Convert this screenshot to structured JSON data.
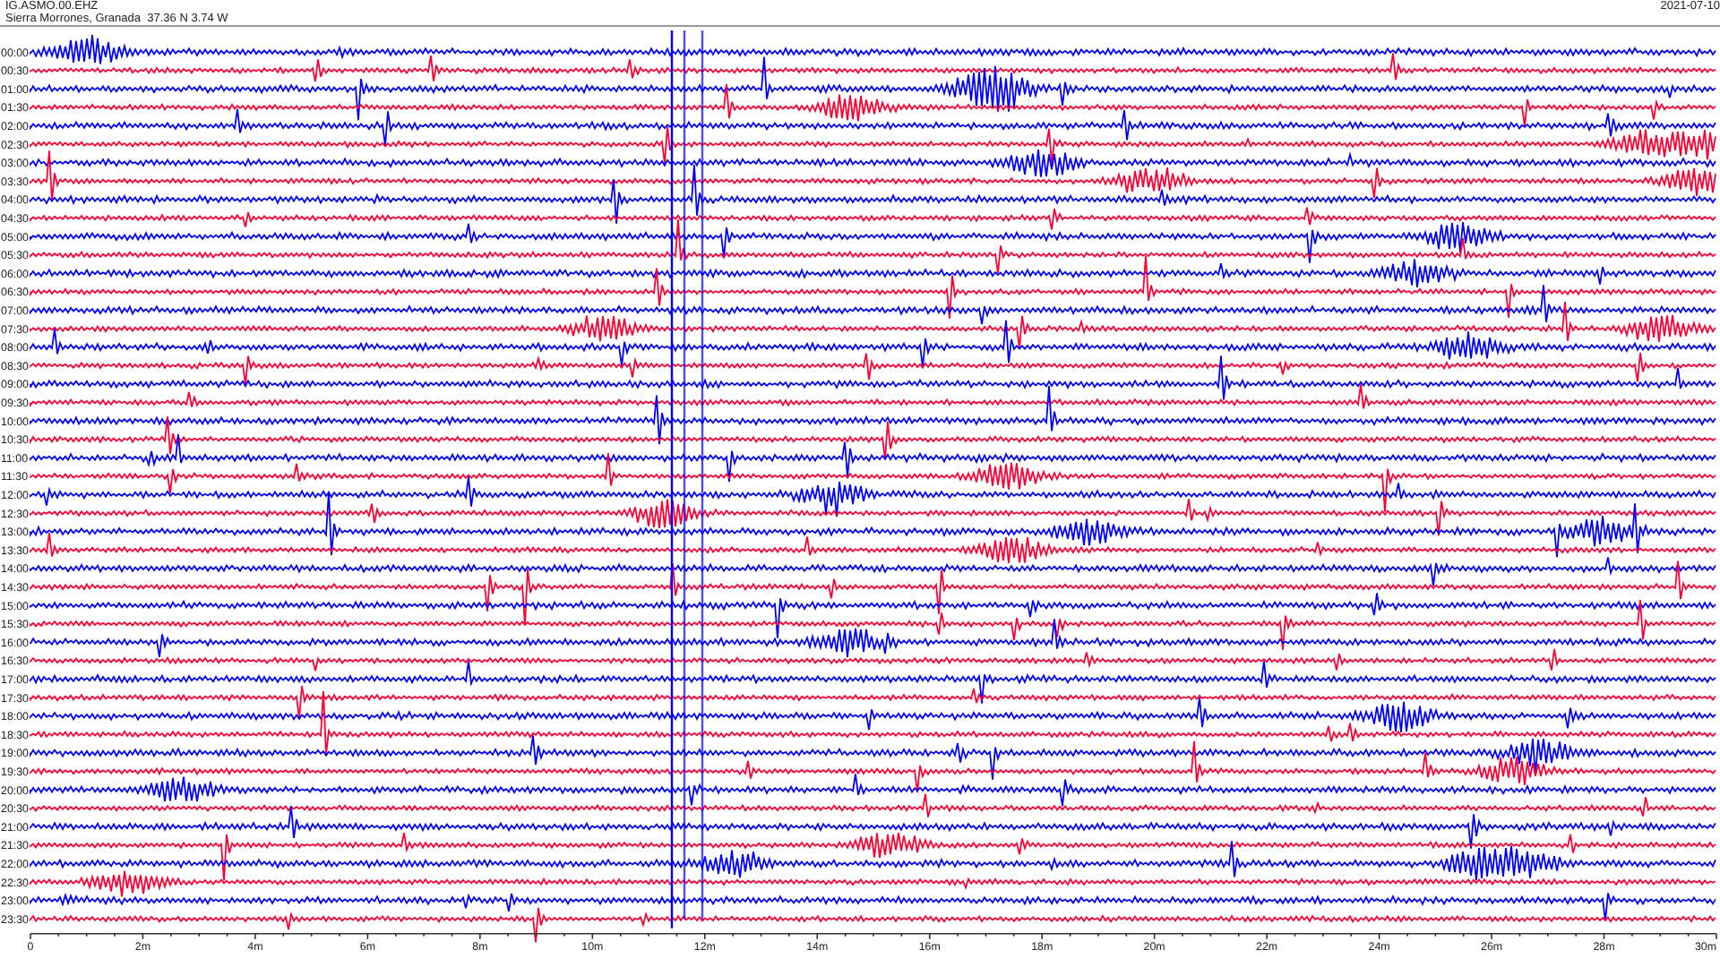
{
  "header": {
    "station": "IG.ASMO.00.EHZ",
    "location": "Sierra Morrones, Granada  37.36 N 3.74 W",
    "date": "2021-07-10"
  },
  "rows": [
    {
      "time": "00:00",
      "color": "#0000ff"
    },
    {
      "time": "00:30",
      "color": "#ff0033"
    },
    {
      "time": "01:00",
      "color": "#0000ff"
    },
    {
      "time": "01:30",
      "color": "#ff0033"
    },
    {
      "time": "02:00",
      "color": "#0000ff"
    },
    {
      "time": "02:30",
      "color": "#ff0033"
    },
    {
      "time": "03:00",
      "color": "#0000ff"
    },
    {
      "time": "03:30",
      "color": "#ff0033"
    },
    {
      "time": "04:00",
      "color": "#0000ff"
    },
    {
      "time": "04:30",
      "color": "#ff0033"
    },
    {
      "time": "05:00",
      "color": "#0000ff"
    },
    {
      "time": "05:30",
      "color": "#ff0033"
    },
    {
      "time": "06:00",
      "color": "#0000ff"
    },
    {
      "time": "06:30",
      "color": "#ff0033"
    },
    {
      "time": "07:00",
      "color": "#0000ff"
    },
    {
      "time": "07:30",
      "color": "#ff0033"
    },
    {
      "time": "08:00",
      "color": "#0000ff"
    },
    {
      "time": "08:30",
      "color": "#ff0033"
    },
    {
      "time": "09:00",
      "color": "#0000ff"
    },
    {
      "time": "09:30",
      "color": "#ff0033"
    },
    {
      "time": "10:00",
      "color": "#0000ff"
    },
    {
      "time": "10:30",
      "color": "#ff0033"
    },
    {
      "time": "11:00",
      "color": "#0000ff"
    },
    {
      "time": "11:30",
      "color": "#ff0033"
    },
    {
      "time": "12:00",
      "color": "#0000ff"
    },
    {
      "time": "12:30",
      "color": "#ff0033"
    },
    {
      "time": "13:00",
      "color": "#0000ff"
    },
    {
      "time": "13:30",
      "color": "#ff0033"
    },
    {
      "time": "14:00",
      "color": "#0000ff"
    },
    {
      "time": "14:30",
      "color": "#ff0033"
    },
    {
      "time": "15:00",
      "color": "#0000ff"
    },
    {
      "time": "15:30",
      "color": "#ff0033"
    },
    {
      "time": "16:00",
      "color": "#0000ff"
    },
    {
      "time": "16:30",
      "color": "#ff0033"
    },
    {
      "time": "17:00",
      "color": "#0000ff"
    },
    {
      "time": "17:30",
      "color": "#ff0033"
    },
    {
      "time": "18:00",
      "color": "#0000ff"
    },
    {
      "time": "18:30",
      "color": "#ff0033"
    },
    {
      "time": "19:00",
      "color": "#0000ff"
    },
    {
      "time": "19:30",
      "color": "#ff0033"
    },
    {
      "time": "20:00",
      "color": "#0000ff"
    },
    {
      "time": "20:30",
      "color": "#ff0033"
    },
    {
      "time": "21:00",
      "color": "#0000ff"
    },
    {
      "time": "21:30",
      "color": "#ff0033"
    },
    {
      "time": "22:00",
      "color": "#0000ff"
    },
    {
      "time": "22:30",
      "color": "#ff0033"
    },
    {
      "time": "23:00",
      "color": "#0000ff"
    },
    {
      "time": "23:30",
      "color": "#ff0033"
    }
  ],
  "axis": {
    "ticks": [
      "0",
      "2m",
      "4m",
      "6m",
      "8m",
      "10m",
      "12m",
      "14m",
      "16m",
      "18m",
      "20m",
      "22m",
      "24m",
      "26m",
      "28m",
      "30m"
    ]
  }
}
